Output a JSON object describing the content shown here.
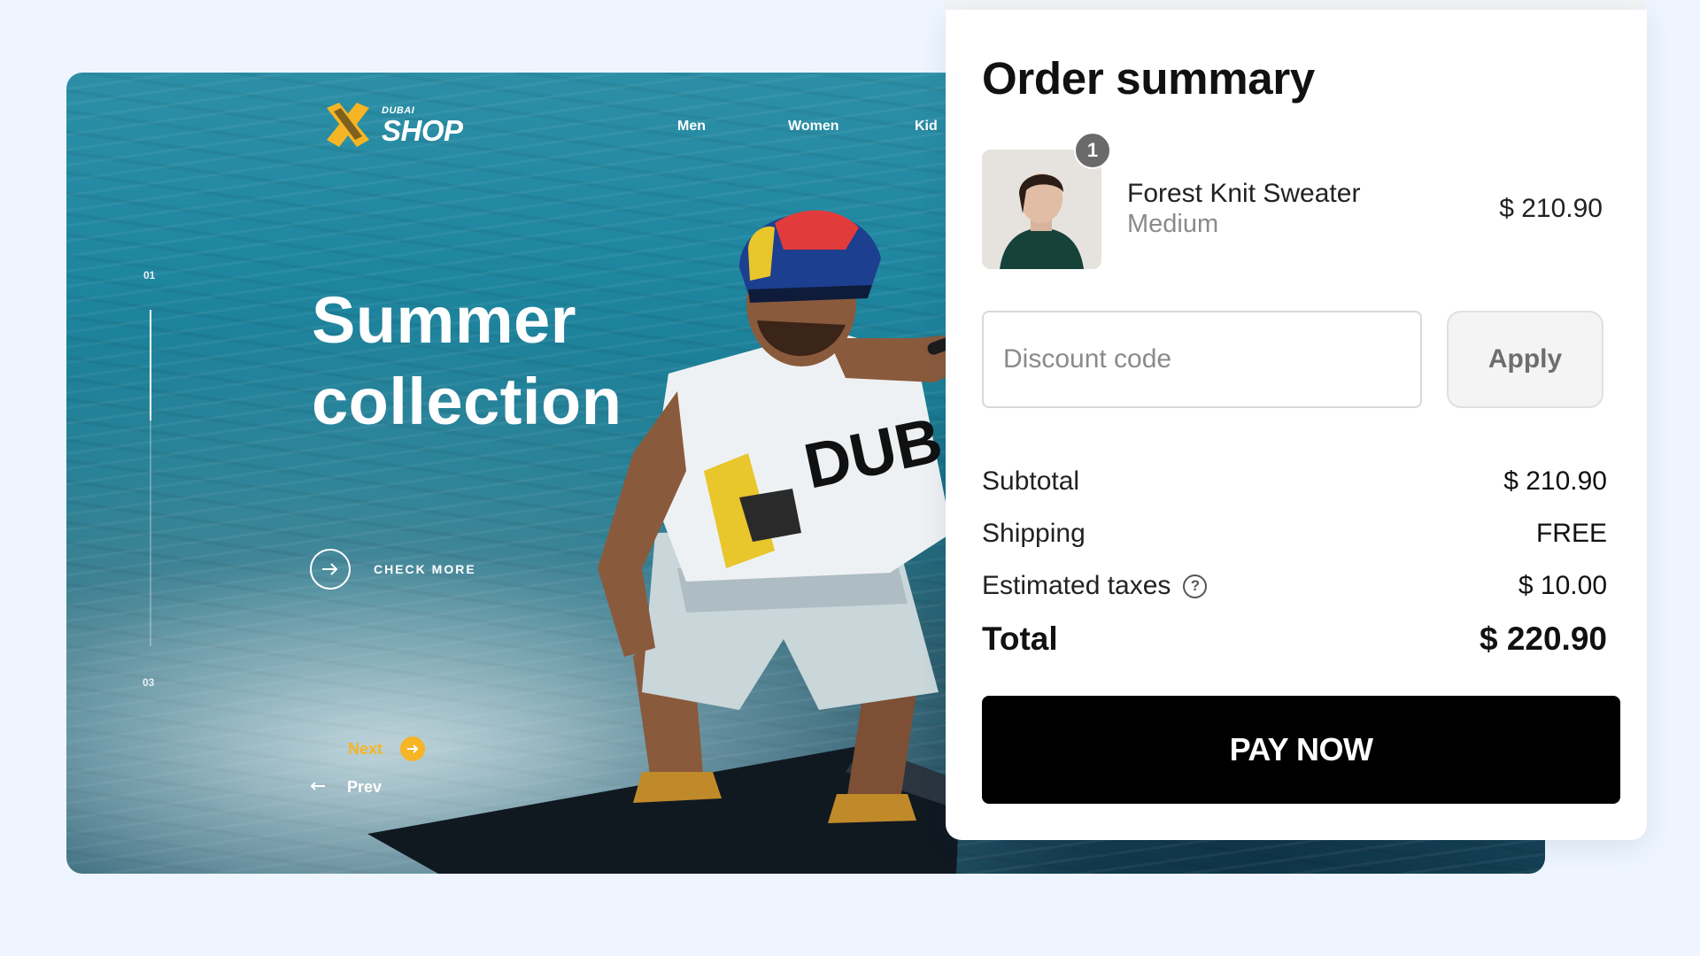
{
  "hero": {
    "brand_small": "DUBAI",
    "brand_big": "SHOP",
    "nav": [
      "Men",
      "Women",
      "Kid"
    ],
    "slide_start": "01",
    "slide_end": "03",
    "slide_progress": 0.33,
    "title_line1": "Summer",
    "title_line2": "collection",
    "check_more": "CHECK MORE",
    "next": "Next",
    "prev": "Prev",
    "shirt_text": "DUBA",
    "accent_color": "#f5b524"
  },
  "order": {
    "title": "Order summary",
    "item": {
      "quantity": "1",
      "name": "Forest Knit Sweater",
      "variant": "Medium",
      "price": "$ 210.90"
    },
    "discount_placeholder": "Discount code",
    "apply_label": "Apply",
    "subtotal_label": "Subtotal",
    "subtotal_value": "$ 210.90",
    "shipping_label": "Shipping",
    "shipping_value": "FREE",
    "taxes_label": "Estimated taxes",
    "taxes_value": "$ 10.00",
    "help_icon": "?",
    "total_label": "Total",
    "total_value": "$ 220.90",
    "pay_label": "PAY NOW"
  }
}
